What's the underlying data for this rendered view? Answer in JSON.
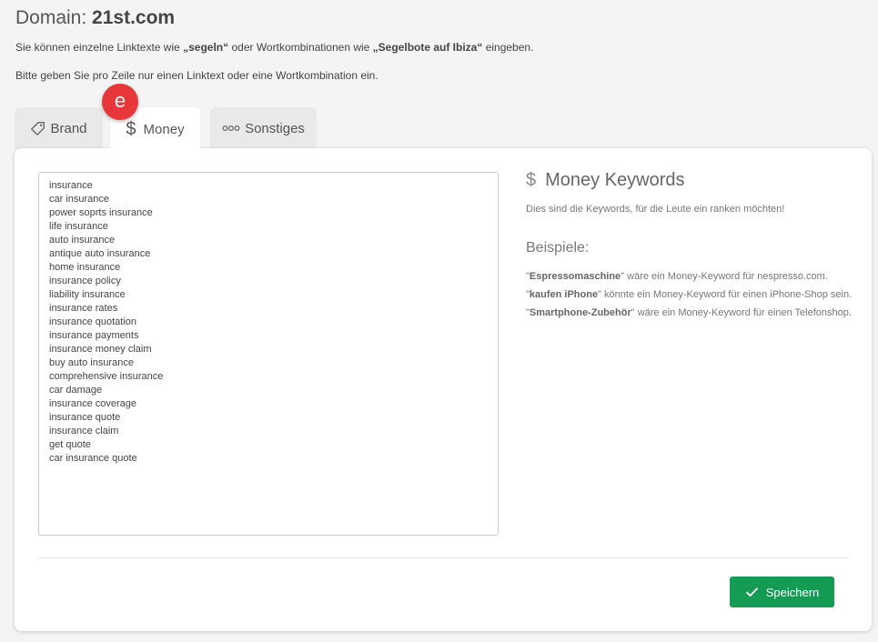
{
  "header": {
    "domain_label": "Domain:",
    "domain_value": "21st.com",
    "intro1_prefix": "Sie können einzelne Linktexte wie ",
    "intro1_example1": "„segeln“",
    "intro1_middle": " oder Wortkombinationen wie ",
    "intro1_example2": "„Segelbote auf Ibiza“",
    "intro1_suffix": " eingeben.",
    "intro2": "Bitte geben Sie pro Zeile nur einen Linktext oder eine Wortkombination ein."
  },
  "badge": {
    "label": "e",
    "color": "#e8373a"
  },
  "tabs": [
    {
      "label": "Brand",
      "icon": "tag-icon",
      "active": false
    },
    {
      "label": "Money",
      "icon": "dollar-icon",
      "active": true
    },
    {
      "label": "Sonstiges",
      "icon": "dots-icon",
      "active": false
    }
  ],
  "keywords_text": "insurance\ncar insurance\npower soprts insurance\nlife insurance\nauto insurance\nantique auto insurance\nhome insurance\ninsurance policy\nliability insurance\ninsurance rates\ninsurance quotation\ninsurance payments\ninsurance money claim\nbuy auto insurance\ncomprehensive insurance\ncar damage\ninsurance coverage\ninsurance quote\ninsurance claim\nget quote\ncar insurance quote",
  "info": {
    "icon_symbol": "$",
    "title": "Money Keywords",
    "subtitle": "Dies sind die Keywords, für die Leute ein ranken möchten!",
    "examples_title": "Beispiele:",
    "examples": [
      {
        "keyword": "Espressomaschine",
        "text": " wäre ein Money-Keyword für nespresso.com."
      },
      {
        "keyword": "kaufen iPhone",
        "text": " könnte ein Money-Keyword für einen iPhone-Shop sein."
      },
      {
        "keyword": "Smartphone-Zubehör",
        "text": " wäre ein Money-Keyword für einen Telefonshop."
      }
    ]
  },
  "save_button": {
    "label": "Speichern",
    "color": "#169b55"
  }
}
